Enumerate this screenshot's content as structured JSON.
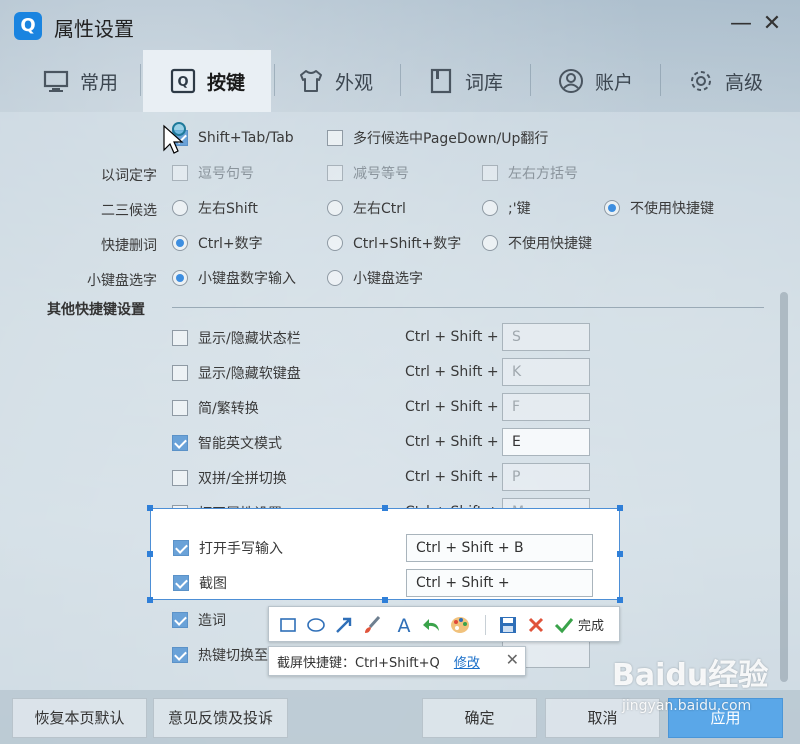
{
  "window": {
    "title": "属性设置",
    "app_icon": "Q",
    "minimize_symbol": "—",
    "close_symbol": "✕"
  },
  "tabs": [
    {
      "label": "常用",
      "icon": "monitor-icon"
    },
    {
      "label": "按键",
      "icon": "keyboard-q-icon",
      "active": true
    },
    {
      "label": "外观",
      "icon": "tshirt-icon"
    },
    {
      "label": "词库",
      "icon": "book-icon"
    },
    {
      "label": "账户",
      "icon": "user-icon"
    },
    {
      "label": "高级",
      "icon": "gear-icon"
    }
  ],
  "top_options": {
    "shift_tab": {
      "label": "Shift+Tab/Tab",
      "checked": true
    },
    "multi_page": {
      "label": "多行候选中PageDown/Up翻行",
      "checked": false
    }
  },
  "word_select": {
    "label": "以词定字",
    "options": [
      {
        "label": "逗号句号",
        "checked": false
      },
      {
        "label": "减号等号",
        "checked": false
      },
      {
        "label": "左右方括号",
        "checked": false
      }
    ]
  },
  "second_third": {
    "label": "二三候选",
    "options": [
      {
        "label": "左右Shift",
        "checked": false
      },
      {
        "label": "左右Ctrl",
        "checked": false
      },
      {
        "label": ";'键",
        "checked": false
      },
      {
        "label": "不使用快捷键",
        "checked": true
      }
    ]
  },
  "quick_delete": {
    "label": "快捷删词",
    "options": [
      {
        "label": "Ctrl+数字",
        "checked": true
      },
      {
        "label": "Ctrl+Shift+数字",
        "checked": false
      },
      {
        "label": "不使用快捷键",
        "checked": false
      }
    ]
  },
  "keypad_select": {
    "label": "小键盘选字",
    "options": [
      {
        "label": "小键盘数字输入",
        "checked": true
      },
      {
        "label": "小键盘选字",
        "checked": false
      }
    ]
  },
  "other_hotkeys": {
    "title": "其他快捷键设置",
    "prefix": "Ctrl + Shift +",
    "items": [
      {
        "label": "显示/隐藏状态栏",
        "checked": false,
        "key": "S"
      },
      {
        "label": "显示/隐藏软键盘",
        "checked": false,
        "key": "K"
      },
      {
        "label": "简/繁转换",
        "checked": false,
        "key": "F"
      },
      {
        "label": "智能英文模式",
        "checked": true,
        "key": "E"
      },
      {
        "label": "双拼/全拼切换",
        "checked": false,
        "key": "P"
      },
      {
        "label": "打开属性设置",
        "checked": false,
        "key": "M"
      },
      {
        "label": "打开手写输入",
        "checked": true,
        "key": "Ctrl + Shift + B"
      },
      {
        "label": "截图",
        "checked": true,
        "key": "Ctrl + Shift +"
      },
      {
        "label": "造词",
        "checked": true
      },
      {
        "label": "热键切换至",
        "checked": true
      }
    ]
  },
  "screenshot_toolbar": {
    "tools": [
      "rectangle-tool-icon",
      "ellipse-tool-icon",
      "arrow-tool-icon",
      "brush-tool-icon",
      "text-tool-icon",
      "undo-icon",
      "palette-icon",
      "save-icon",
      "cancel-icon",
      "confirm-icon"
    ],
    "done_label": "完成"
  },
  "screenshot_tip": {
    "text": "截屏快捷键：Ctrl+Shift+Q",
    "link": "修改",
    "close": "✕"
  },
  "bottom": {
    "restore_label": "恢复本页默认",
    "feedback_label": "意见反馈及投诉",
    "ok_label": "确定",
    "cancel_label": "取消",
    "apply_label": "应用"
  },
  "watermark": {
    "main": "Baidu经验",
    "sub": "jingyan.baidu.com"
  },
  "colors": {
    "accent": "#3d8ee0",
    "selection_border": "#4d8fd6",
    "link": "#1a6fc9"
  }
}
